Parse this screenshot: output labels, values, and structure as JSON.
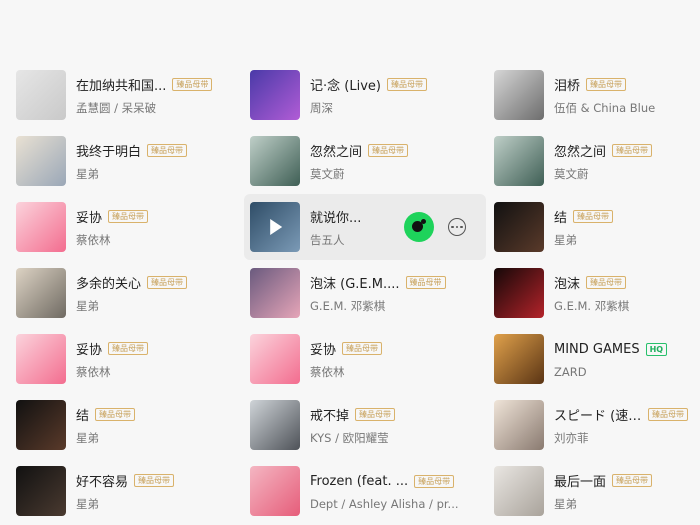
{
  "badges": {
    "premium": "臻品母带",
    "hq": "HQ"
  },
  "songs": [
    {
      "title": "在加纳共和国...",
      "artist": "孟慧圆 / 呆呆破",
      "badge": "premium",
      "cover": [
        "#e6e6e6",
        "#c9c9c9"
      ]
    },
    {
      "title": "记·念 (Live)",
      "artist": "周深",
      "badge": "premium",
      "cover": [
        "#4a3aa8",
        "#b15cd6"
      ]
    },
    {
      "title": "泪桥",
      "artist": "伍佰 & China Blue",
      "badge": "premium",
      "cover": [
        "#d6d6d6",
        "#6d6d6d"
      ]
    },
    {
      "title": "我终于明白",
      "artist": "星弟",
      "badge": "premium",
      "cover": [
        "#e9e1d3",
        "#9aa7b7"
      ]
    },
    {
      "title": "忽然之间",
      "artist": "莫文蔚",
      "badge": "premium",
      "cover": [
        "#bfcfc8",
        "#3f5f55"
      ]
    },
    {
      "title": "忽然之间",
      "artist": "莫文蔚",
      "badge": "premium",
      "cover": [
        "#bfcfc8",
        "#3f5f55"
      ]
    },
    {
      "title": "妥协",
      "artist": "蔡依林",
      "badge": "premium",
      "cover": [
        "#fbd3dc",
        "#f36d8f"
      ]
    },
    {
      "title": "就说你...",
      "artist": "告五人",
      "badge": "",
      "cover": [
        "#2f4d67",
        "#7b9ab6"
      ],
      "hover": true
    },
    {
      "title": "结",
      "artist": "星弟",
      "badge": "premium",
      "cover": [
        "#111111",
        "#5a3a2a"
      ]
    },
    {
      "title": "多余的关心",
      "artist": "星弟",
      "badge": "premium",
      "cover": [
        "#ddd3c4",
        "#6f6a62"
      ]
    },
    {
      "title": "泡沫 (G.E.M....",
      "artist": "G.E.M. 邓紫棋",
      "badge": "premium",
      "cover": [
        "#6a5a7e",
        "#e6a5b8"
      ]
    },
    {
      "title": "泡沫",
      "artist": "G.E.M. 邓紫棋",
      "badge": "premium",
      "cover": [
        "#150808",
        "#b4232a"
      ]
    },
    {
      "title": "妥协",
      "artist": "蔡依林",
      "badge": "premium",
      "cover": [
        "#fbd3dc",
        "#f36d8f"
      ]
    },
    {
      "title": "妥协",
      "artist": "蔡依林",
      "badge": "premium",
      "cover": [
        "#fbd3dc",
        "#f36d8f"
      ]
    },
    {
      "title": "MIND GAMES",
      "artist": "ZARD",
      "badge": "hq",
      "cover": [
        "#e0a14b",
        "#5a3414"
      ]
    },
    {
      "title": "结",
      "artist": "星弟",
      "badge": "premium",
      "cover": [
        "#111111",
        "#5a3a2a"
      ]
    },
    {
      "title": "戒不掉",
      "artist": "KYS / 欧阳耀莹",
      "badge": "premium",
      "cover": [
        "#cfd4d8",
        "#4e5258"
      ]
    },
    {
      "title": "スピード (速度)",
      "artist": "刘亦菲",
      "badge": "premium",
      "cover": [
        "#efe4d8",
        "#8a7a70"
      ]
    },
    {
      "title": "好不容易",
      "artist": "星弟",
      "badge": "premium",
      "cover": [
        "#111111",
        "#4a3a30"
      ]
    },
    {
      "title": "Frozen (feat. ...",
      "artist": "Dept / Ashley Alisha / pr...",
      "badge": "premium",
      "cover": [
        "#f4b6c2",
        "#e65d7a"
      ]
    },
    {
      "title": "最后一面",
      "artist": "星弟",
      "badge": "premium",
      "cover": [
        "#e9e6e2",
        "#a9a39b"
      ]
    }
  ]
}
